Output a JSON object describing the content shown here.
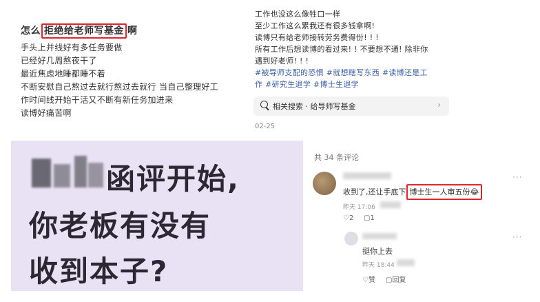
{
  "left_post": {
    "title_before": "怎么",
    "title_highlight": "拒绝给老师写基金",
    "title_after": "啊",
    "lines": [
      "手头上并线好有多任务要做",
      "已经好几周熬夜干了",
      "最近焦虑地睡都睡不着",
      "不断安慰自己熬过去就行熬过去就行 当自己整理好工",
      "作时间线开始干活又不断有新任务加进来",
      "读博好痛苦啊"
    ]
  },
  "right_post": {
    "lines": [
      "工作也没这么像牲口一样",
      "至少工作这么累我还有很多钱拿啊!",
      "读博只有给老师接转劳务费得份! ! !",
      "所有工作后想读博的看过来! ! 不要想不通! 除非你",
      "遇到好老师! ! !"
    ],
    "tags_line1": "#被导师支配的恐惧 #就想瞎写东西 #读博还是工",
    "tags_line2": "作 #研究生退学 #博士生退学",
    "related_search": "相关搜索 · 给导师写基金",
    "date": "02-25"
  },
  "image_overlay": {
    "line1": "函评开始,",
    "line2": "你老板有没有",
    "line3": "收到本子?"
  },
  "comments": {
    "count_label": "共 34 条评论",
    "items": [
      {
        "text_before": "收到了,还让手底下",
        "text_highlight": "博士生一人审五份",
        "emoji": "😂",
        "time": "昨天 17:06",
        "likes": "2",
        "replies": "1"
      },
      {
        "text": "挺你上去",
        "time": "昨天 18:44",
        "like_label": "赞",
        "reply_label": "回复"
      }
    ]
  },
  "colors": {
    "highlight_border": "#e0252b",
    "tag": "#3b5fa8",
    "panel_bg": "#e8e2f4"
  }
}
